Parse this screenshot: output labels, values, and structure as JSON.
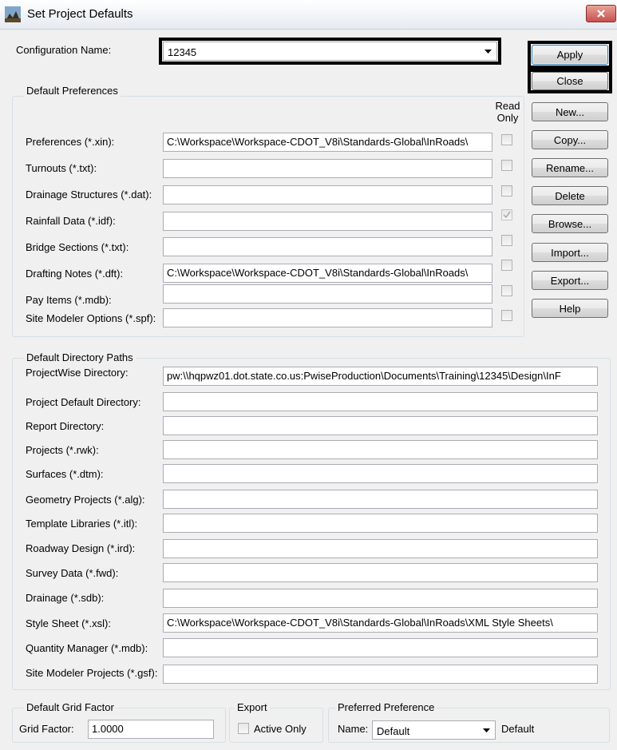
{
  "window": {
    "title": "Set Project Defaults"
  },
  "config": {
    "label": "Configuration Name:",
    "value": "12345"
  },
  "buttons": {
    "apply": "Apply",
    "close": "Close",
    "new": "New...",
    "copy": "Copy...",
    "rename": "Rename...",
    "delete": "Delete",
    "browse": "Browse...",
    "import": "Import...",
    "export": "Export...",
    "help": "Help"
  },
  "preferences": {
    "title": "Default Preferences",
    "read_only_line1": "Read",
    "read_only_line2": "Only",
    "rows": [
      {
        "label": "Preferences (*.xin):",
        "value": "C:\\Workspace\\Workspace-CDOT_V8i\\Standards-Global\\InRoads\\",
        "read_only": false
      },
      {
        "label": "Turnouts (*.txt):",
        "value": "",
        "read_only": false
      },
      {
        "label": "Drainage Structures (*.dat):",
        "value": "",
        "read_only": false
      },
      {
        "label": "Rainfall Data (*.idf):",
        "value": "",
        "read_only": true
      },
      {
        "label": "Bridge Sections (*.txt):",
        "value": "",
        "read_only": false
      },
      {
        "label": "Drafting Notes (*.dft):",
        "value": "C:\\Workspace\\Workspace-CDOT_V8i\\Standards-Global\\InRoads\\",
        "read_only": false
      },
      {
        "label": "Pay Items (*.mdb):",
        "value": "",
        "read_only": false
      },
      {
        "label": "Site Modeler Options (*.spf):",
        "value": "",
        "read_only": false
      }
    ]
  },
  "directories": {
    "title": "Default Directory Paths",
    "rows": [
      {
        "label": "ProjectWise Directory:",
        "value": "pw:\\\\hqpwz01.dot.state.co.us:PwiseProduction\\Documents\\Training\\12345\\Design\\InF"
      },
      {
        "label": "Project Default Directory:",
        "value": ""
      },
      {
        "label": "Report Directory:",
        "value": ""
      },
      {
        "label": "Projects (*.rwk):",
        "value": ""
      },
      {
        "label": "Surfaces (*.dtm):",
        "value": ""
      },
      {
        "label": "Geometry Projects (*.alg):",
        "value": ""
      },
      {
        "label": "Template Libraries (*.itl):",
        "value": ""
      },
      {
        "label": "Roadway Design (*.ird):",
        "value": ""
      },
      {
        "label": "Survey Data (*.fwd):",
        "value": ""
      },
      {
        "label": "Drainage (*.sdb):",
        "value": ""
      },
      {
        "label": "Style Sheet (*.xsl):",
        "value": "C:\\Workspace\\Workspace-CDOT_V8i\\Standards-Global\\InRoads\\XML Style Sheets\\"
      },
      {
        "label": "Quantity Manager (*.mdb):",
        "value": ""
      },
      {
        "label": "Site Modeler Projects (*.gsf):",
        "value": ""
      }
    ]
  },
  "grid": {
    "title": "Default Grid Factor",
    "label": "Grid Factor:",
    "value": "1.0000"
  },
  "export_group": {
    "title": "Export",
    "checkbox_label": "Active Only",
    "checked": false
  },
  "preferred": {
    "title": "Preferred Preference",
    "name_label": "Name:",
    "value": "Default",
    "status": "Default"
  }
}
